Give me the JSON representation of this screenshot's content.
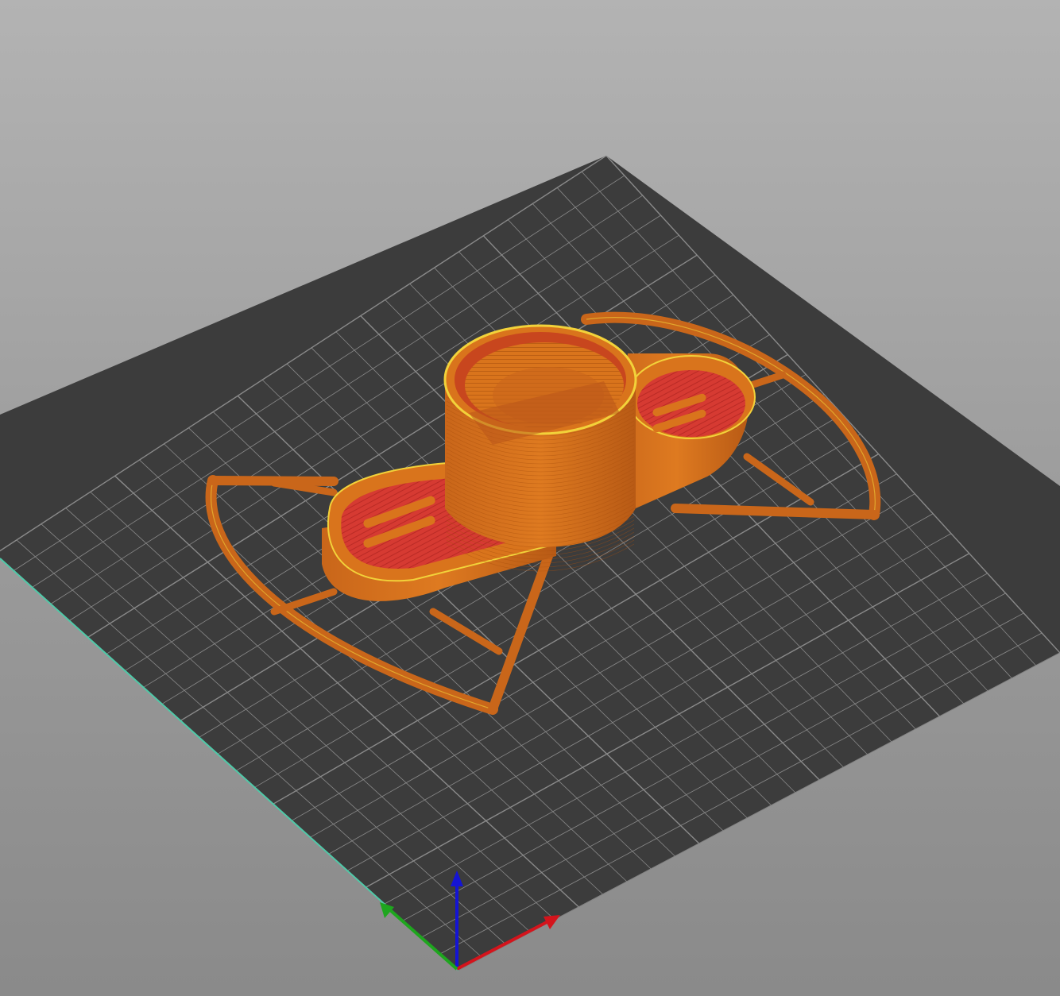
{
  "viewport": {
    "background_top": "#b3b3b3",
    "background_bottom": "#8a8a8a"
  },
  "bed": {
    "color": "#3c3c3c",
    "grid_color": "#8a8a8a",
    "edge_highlight": "#4fc9a8"
  },
  "model": {
    "perimeter_color": "#d9741c",
    "outer_wall_color": "#c9661a",
    "top_infill_color": "#d63a32",
    "highlight_color": "#f2d23a"
  },
  "axes": {
    "x_color": "#d4141c",
    "y_color": "#1ea61e",
    "z_color": "#1414d4"
  }
}
